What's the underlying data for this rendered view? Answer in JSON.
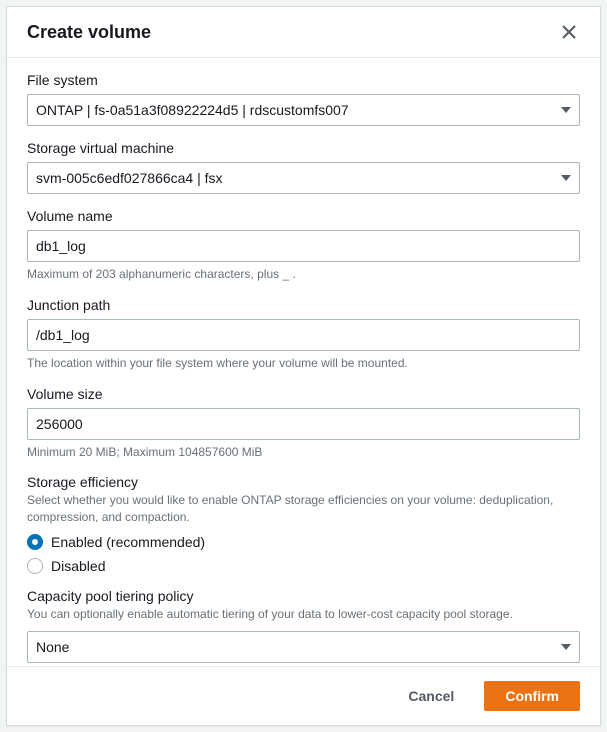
{
  "header": {
    "title": "Create volume"
  },
  "file_system": {
    "label": "File system",
    "selected": "ONTAP | fs-0a51a3f08922224d5 | rdscustomfs007"
  },
  "svm": {
    "label": "Storage virtual machine",
    "selected": "svm-005c6edf027866ca4 | fsx"
  },
  "volume_name": {
    "label": "Volume name",
    "value": "db1_log",
    "helper": "Maximum of 203 alphanumeric characters, plus _ ."
  },
  "junction_path": {
    "label": "Junction path",
    "value": "/db1_log",
    "helper": "The location within your file system where your volume will be mounted."
  },
  "volume_size": {
    "label": "Volume size",
    "value": "256000",
    "helper": "Minimum 20 MiB; Maximum 104857600 MiB"
  },
  "storage_efficiency": {
    "label": "Storage efficiency",
    "helper": "Select whether you would like to enable ONTAP storage efficiencies on your volume: deduplication, compression, and compaction.",
    "options": {
      "enabled": "Enabled (recommended)",
      "disabled": "Disabled"
    }
  },
  "tiering": {
    "label": "Capacity pool tiering policy",
    "helper": "You can optionally enable automatic tiering of your data to lower-cost capacity pool storage.",
    "selected": "None"
  },
  "footer": {
    "cancel": "Cancel",
    "confirm": "Confirm"
  }
}
